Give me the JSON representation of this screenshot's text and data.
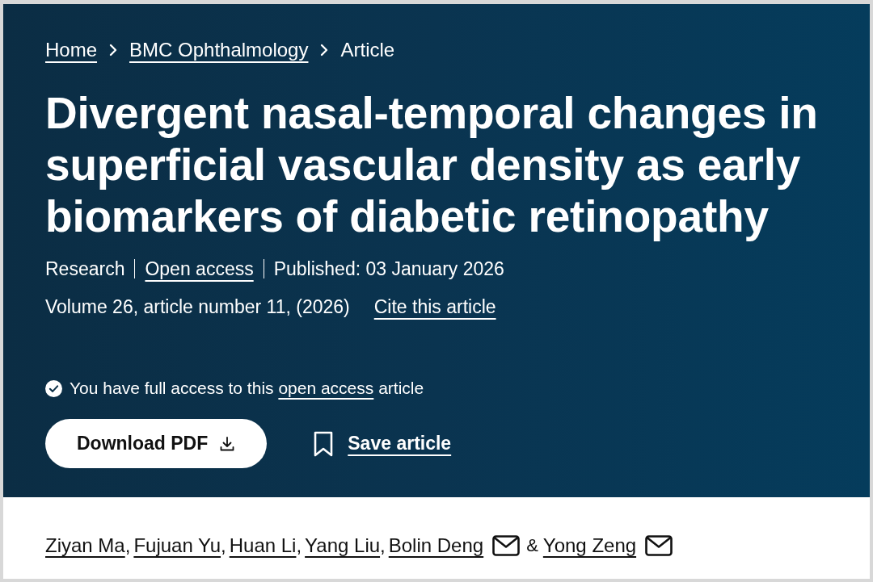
{
  "breadcrumbs": [
    {
      "label": "Home",
      "current": false
    },
    {
      "label": "BMC Ophthalmology",
      "current": false
    },
    {
      "label": "Article",
      "current": true
    }
  ],
  "title": "Divergent nasal-temporal changes in superficial vascular density as early biomarkers of diabetic retinopathy",
  "meta": [
    {
      "label": "Research",
      "link": false
    },
    {
      "label": "Open access",
      "link": true
    },
    {
      "label": "Published: 03 January 2026",
      "link": false
    }
  ],
  "citation": {
    "volume": "Volume 26, article number 11, (2026)",
    "cite_link": "Cite this article"
  },
  "access_note": {
    "before": "You have full access to this",
    "link": "open access",
    "after": "article"
  },
  "actions": [
    {
      "kind": "button",
      "label": "Download PDF"
    },
    {
      "kind": "link",
      "label": "Save article"
    }
  ],
  "authors": [
    {
      "name": "Ziyan Ma",
      "email": false,
      "separator": ","
    },
    {
      "name": "Fujuan Yu",
      "email": false,
      "separator": ","
    },
    {
      "name": "Huan Li",
      "email": false,
      "separator": ","
    },
    {
      "name": "Yang Liu",
      "email": false,
      "separator": ","
    },
    {
      "name": "Bolin Deng",
      "email": true,
      "separator": "&"
    },
    {
      "name": "Yong Zeng",
      "email": true
    }
  ]
}
